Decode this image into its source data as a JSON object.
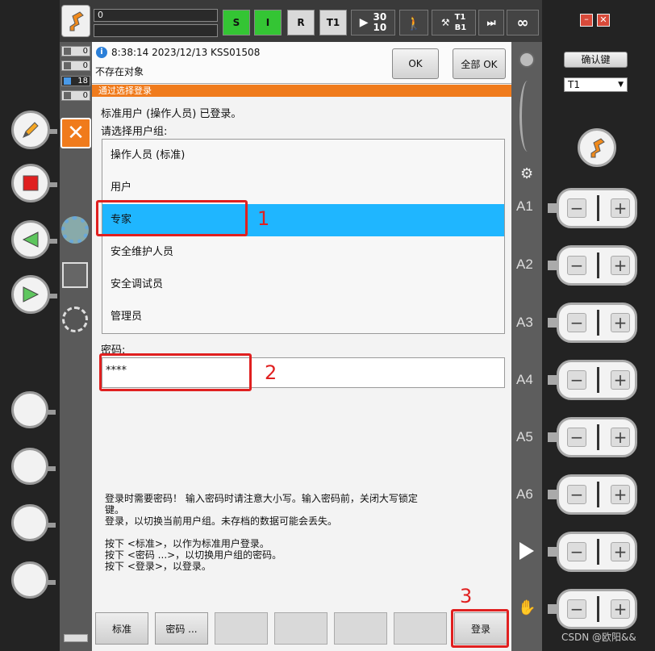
{
  "topbar": {
    "field_value": "0",
    "field2_value": "",
    "btn_s": "S",
    "btn_i": "I",
    "btn_r": "R",
    "btn_t1": "T1",
    "speed_top": "30",
    "speed_bottom": "10",
    "tool_top": "T1",
    "tool_bottom": "B1",
    "infinity": "∞"
  },
  "message": {
    "counters": [
      "0",
      "0",
      "18",
      "0"
    ],
    "text_line1": "8:38:14 2023/12/13 KSS01508",
    "text_line2": "不存在对象",
    "ok_label": "OK",
    "all_ok_label": "全部 OK"
  },
  "dialog": {
    "title": "通过选择登录",
    "logged_in_text": "标准用户 (操作人员) 已登录。",
    "choose_group_text": "请选择用户组:",
    "groups": [
      "操作人员 (标准)",
      "用户",
      "专家",
      "安全维护人员",
      "安全调试员",
      "管理员"
    ],
    "selected_group": "专家",
    "password_label": "密码:",
    "password_value": "****",
    "help_lines": [
      "登录时需要密码！ 输入密码时请注意大小写。输入密码前，关闭大写锁定",
      "键。",
      "登录，以切换当前用户组。未存档的数据可能会丢失。",
      "",
      "按下 <标准>，以作为标准用户登录。",
      "按下 <密码 ...>，以切换用户组的密码。",
      "按下 <登录>，以登录。"
    ],
    "buttons": {
      "standard": "标准",
      "password": "密码 ...",
      "login": "登录"
    }
  },
  "annotations": [
    "1",
    "2",
    "3"
  ],
  "right_panel": {
    "confirm_key": "确认键",
    "mode_select": "T1",
    "axes": [
      "A1",
      "A2",
      "A3",
      "A4",
      "A5",
      "A6"
    ]
  },
  "watermark": "CSDN @欧阳&&",
  "colors": {
    "accent": "#f07b1c",
    "selected": "#1fb6ff",
    "annotation": "#e02020",
    "status_green": "#34c534"
  }
}
